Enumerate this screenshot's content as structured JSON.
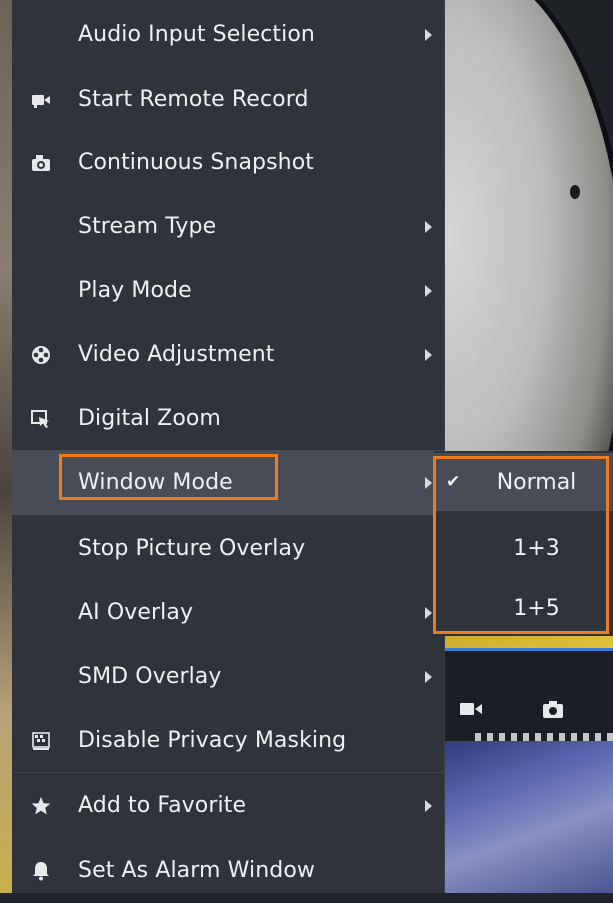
{
  "menu": {
    "items": [
      {
        "label": "Audio Input Selection",
        "icon": "none",
        "submenu": true
      },
      {
        "label": "Start Remote Record",
        "icon": "video-camera-icon",
        "submenu": false
      },
      {
        "label": "Continuous Snapshot",
        "icon": "camera-icon",
        "submenu": false
      },
      {
        "label": "Stream Type",
        "icon": "none",
        "submenu": true
      },
      {
        "label": "Play Mode",
        "icon": "none",
        "submenu": true
      },
      {
        "label": "Video Adjustment",
        "icon": "film-reel-icon",
        "submenu": true
      },
      {
        "label": "Digital Zoom",
        "icon": "zoom-cursor-icon",
        "submenu": false
      },
      {
        "label": "Window Mode",
        "icon": "none",
        "submenu": true,
        "highlighted": true
      },
      {
        "label": "Stop Picture Overlay",
        "icon": "none",
        "submenu": false
      },
      {
        "label": "AI Overlay",
        "icon": "none",
        "submenu": true
      },
      {
        "label": "SMD Overlay",
        "icon": "none",
        "submenu": true
      },
      {
        "label": "Disable Privacy Masking",
        "icon": "privacy-mask-icon",
        "submenu": false
      },
      {
        "label": "Add to Favorite",
        "icon": "star-icon",
        "submenu": true
      },
      {
        "label": "Set As Alarm Window",
        "icon": "bell-icon",
        "submenu": false
      }
    ]
  },
  "submenu": {
    "parent": "Window Mode",
    "items": [
      {
        "label": "Normal",
        "checked": true
      },
      {
        "label": "1+3",
        "checked": false
      },
      {
        "label": "1+5",
        "checked": false
      }
    ],
    "check_glyph": "✔"
  },
  "colors": {
    "menu_bg": "#2f333c",
    "highlight_bg": "#474c57",
    "annotation_border": "#f07a1e",
    "text": "#eef0f2"
  }
}
